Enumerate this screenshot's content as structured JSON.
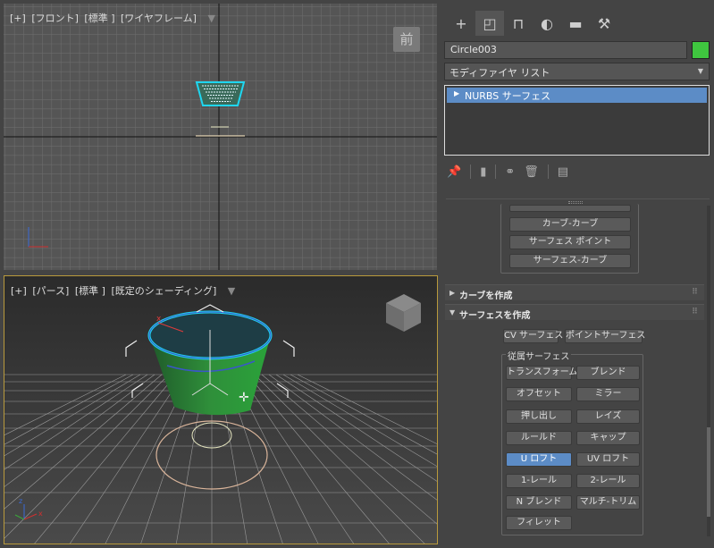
{
  "viewport_front": {
    "label": [
      "[+]",
      "[フロント]",
      "[標準 ]",
      "[ワイヤフレーム]"
    ],
    "nav_label": "前"
  },
  "viewport_persp": {
    "label": [
      "[+]",
      "[パース]",
      "[標準 ]",
      "[既定のシェーディング]"
    ]
  },
  "command_panel": {
    "tabs": [
      {
        "name": "create-tab",
        "glyph": "+"
      },
      {
        "name": "modify-tab",
        "glyph": "◰"
      },
      {
        "name": "hierarchy-tab",
        "glyph": "⊓"
      },
      {
        "name": "motion-tab",
        "glyph": "◐"
      },
      {
        "name": "display-tab",
        "glyph": "▬"
      },
      {
        "name": "utilities-tab",
        "glyph": "🔧"
      }
    ],
    "object_name": "Circle003",
    "object_color": "#3fc63f",
    "modifier_list": "モディファイヤ リスト",
    "stack_item": "NURBS サーフェス"
  },
  "upper_buttons": [
    "カーブ-カーブ",
    "サーフェス ポイント",
    "サーフェス-カーブ"
  ],
  "rollouts": {
    "curve_create": "カーブを作成",
    "surface_create": "サーフェスを作成"
  },
  "surface_buttons": {
    "cv_surface": "CV サーフェス",
    "point_surface": "ポイントサーフェス",
    "dependent_label": "従属サーフェス",
    "transform": "トランスフォーム",
    "blend": "ブレンド",
    "offset": "オフセット",
    "mirror": "ミラー",
    "extrude": "押し出し",
    "lathe": "レイズ",
    "ruled": "ルールド",
    "cap": "キャップ",
    "u_loft": "U ロフト",
    "uv_loft": "UV ロフト",
    "one_rail": "1-レール",
    "two_rail": "2-レール",
    "n_blend": "N ブレンド",
    "multi_trim": "マルチ-トリム",
    "fillet": "フィレット"
  },
  "colors": {
    "selection": "#5c8cc6",
    "active_viewport_border": "#b99a3c",
    "object_green": "#2f8f3a",
    "selection_cyan": "#1fd6f0"
  }
}
